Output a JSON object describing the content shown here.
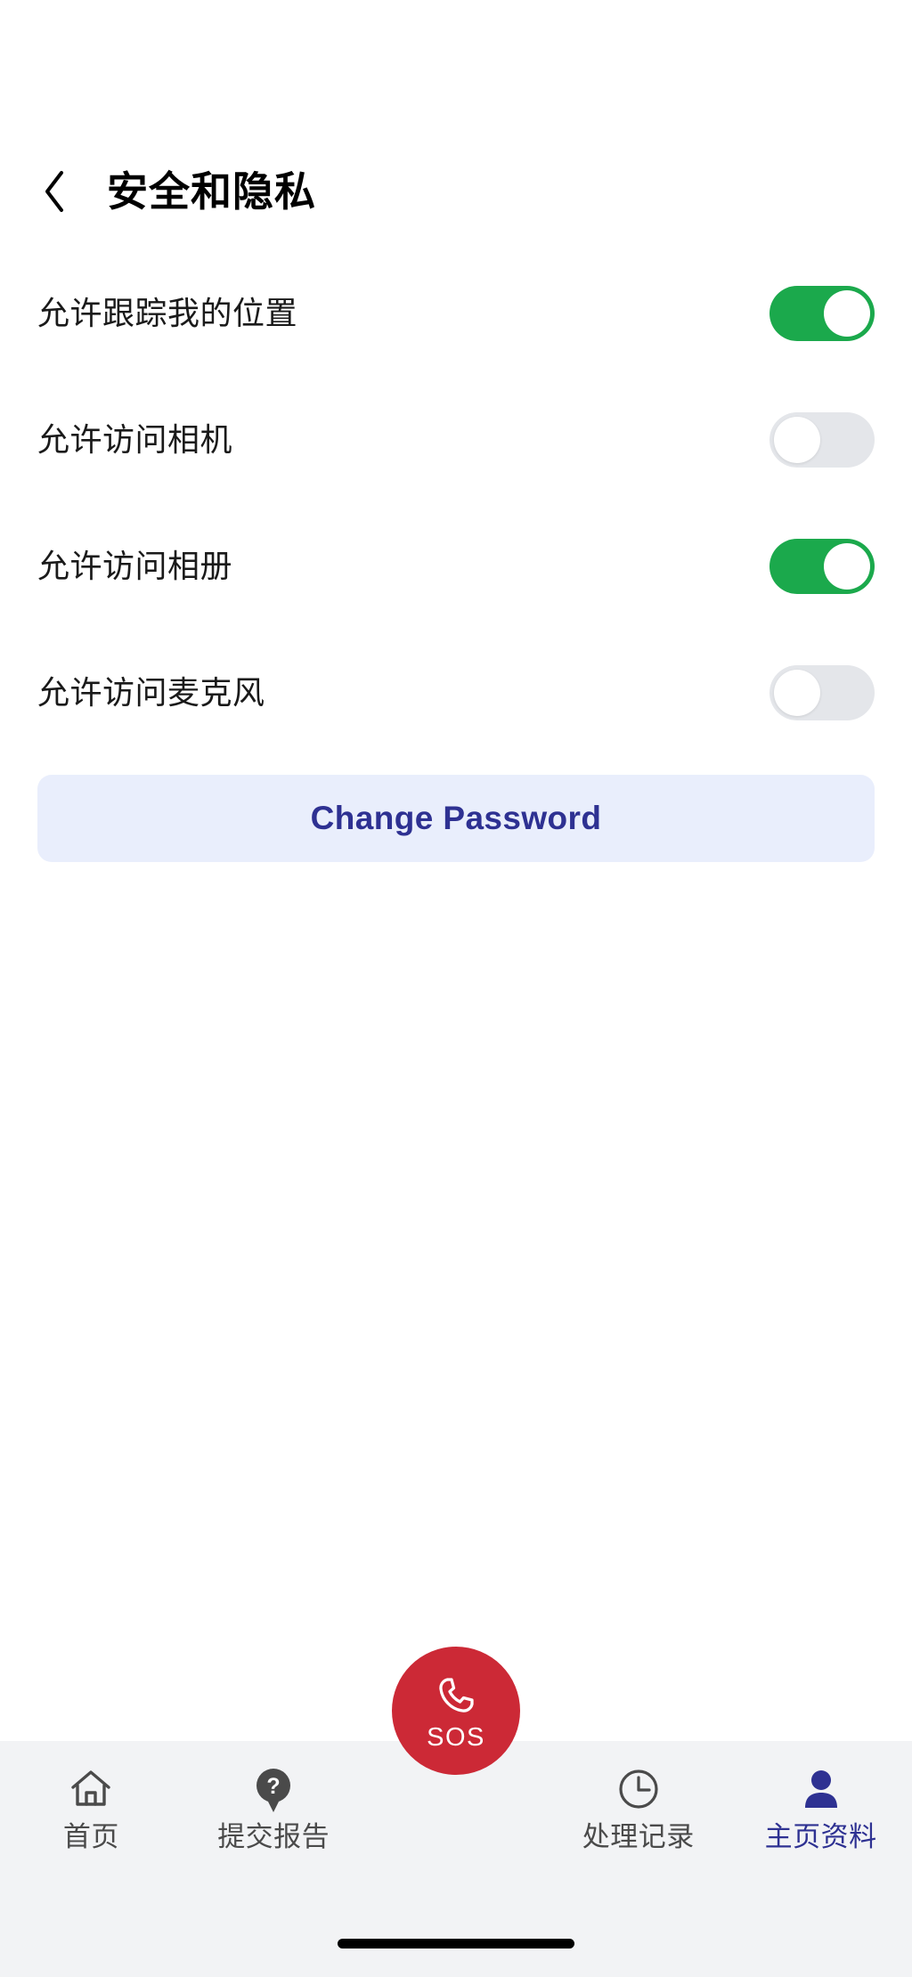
{
  "header": {
    "back_icon": "chevron-left-icon",
    "title": "安全和隐私"
  },
  "settings": {
    "rows": [
      {
        "label": "允许跟踪我的位置",
        "state": "on",
        "toggle_name": "toggle-location-tracking"
      },
      {
        "label": "允许访问相机",
        "state": "off",
        "toggle_name": "toggle-camera-access"
      },
      {
        "label": "允许访问相册",
        "state": "on",
        "toggle_name": "toggle-photo-library-access"
      },
      {
        "label": "允许访问麦克风",
        "state": "off",
        "toggle_name": "toggle-microphone-access"
      }
    ]
  },
  "actions": {
    "change_password_label": "Change Password"
  },
  "bottom_nav": {
    "items": [
      {
        "label": "首页",
        "icon": "home-icon",
        "active": false
      },
      {
        "label": "提交报告",
        "icon": "question-bubble-icon",
        "active": false
      },
      {
        "label": "处理记录",
        "icon": "clock-icon",
        "active": false
      },
      {
        "label": "主页资料",
        "icon": "person-icon",
        "active": true
      }
    ],
    "sos": {
      "label": "SOS",
      "icon": "phone-handset-icon"
    }
  },
  "colors": {
    "accent_navy": "#2E3192",
    "toggle_on_green": "#1BA94C",
    "toggle_off_gray": "#E4E6EA",
    "sos_red": "#CC2936",
    "cta_background": "#E9EEFC",
    "nav_background": "#F2F3F5",
    "nav_inactive_text": "#4A4A4A"
  }
}
